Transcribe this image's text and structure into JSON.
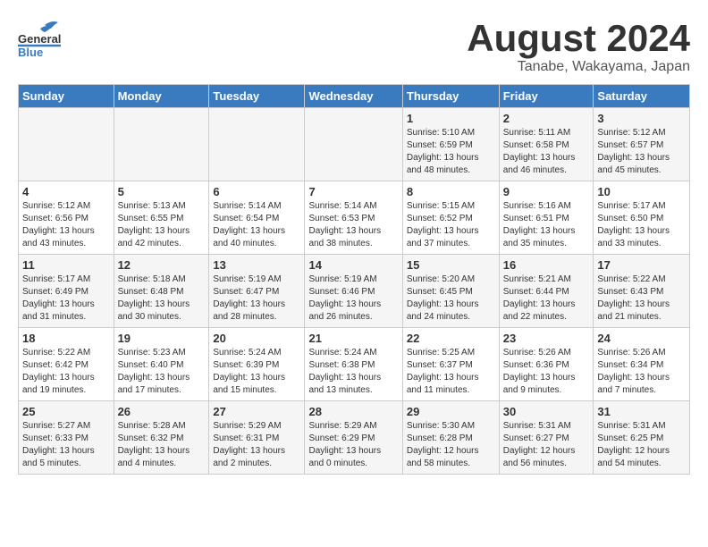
{
  "header": {
    "logo_general": "General",
    "logo_blue": "Blue",
    "title": "August 2024",
    "subtitle": "Tanabe, Wakayama, Japan"
  },
  "columns": [
    "Sunday",
    "Monday",
    "Tuesday",
    "Wednesday",
    "Thursday",
    "Friday",
    "Saturday"
  ],
  "weeks": [
    {
      "days": [
        {
          "num": "",
          "info": ""
        },
        {
          "num": "",
          "info": ""
        },
        {
          "num": "",
          "info": ""
        },
        {
          "num": "",
          "info": ""
        },
        {
          "num": "1",
          "info": "Sunrise: 5:10 AM\nSunset: 6:59 PM\nDaylight: 13 hours\nand 48 minutes."
        },
        {
          "num": "2",
          "info": "Sunrise: 5:11 AM\nSunset: 6:58 PM\nDaylight: 13 hours\nand 46 minutes."
        },
        {
          "num": "3",
          "info": "Sunrise: 5:12 AM\nSunset: 6:57 PM\nDaylight: 13 hours\nand 45 minutes."
        }
      ]
    },
    {
      "days": [
        {
          "num": "4",
          "info": "Sunrise: 5:12 AM\nSunset: 6:56 PM\nDaylight: 13 hours\nand 43 minutes."
        },
        {
          "num": "5",
          "info": "Sunrise: 5:13 AM\nSunset: 6:55 PM\nDaylight: 13 hours\nand 42 minutes."
        },
        {
          "num": "6",
          "info": "Sunrise: 5:14 AM\nSunset: 6:54 PM\nDaylight: 13 hours\nand 40 minutes."
        },
        {
          "num": "7",
          "info": "Sunrise: 5:14 AM\nSunset: 6:53 PM\nDaylight: 13 hours\nand 38 minutes."
        },
        {
          "num": "8",
          "info": "Sunrise: 5:15 AM\nSunset: 6:52 PM\nDaylight: 13 hours\nand 37 minutes."
        },
        {
          "num": "9",
          "info": "Sunrise: 5:16 AM\nSunset: 6:51 PM\nDaylight: 13 hours\nand 35 minutes."
        },
        {
          "num": "10",
          "info": "Sunrise: 5:17 AM\nSunset: 6:50 PM\nDaylight: 13 hours\nand 33 minutes."
        }
      ]
    },
    {
      "days": [
        {
          "num": "11",
          "info": "Sunrise: 5:17 AM\nSunset: 6:49 PM\nDaylight: 13 hours\nand 31 minutes."
        },
        {
          "num": "12",
          "info": "Sunrise: 5:18 AM\nSunset: 6:48 PM\nDaylight: 13 hours\nand 30 minutes."
        },
        {
          "num": "13",
          "info": "Sunrise: 5:19 AM\nSunset: 6:47 PM\nDaylight: 13 hours\nand 28 minutes."
        },
        {
          "num": "14",
          "info": "Sunrise: 5:19 AM\nSunset: 6:46 PM\nDaylight: 13 hours\nand 26 minutes."
        },
        {
          "num": "15",
          "info": "Sunrise: 5:20 AM\nSunset: 6:45 PM\nDaylight: 13 hours\nand 24 minutes."
        },
        {
          "num": "16",
          "info": "Sunrise: 5:21 AM\nSunset: 6:44 PM\nDaylight: 13 hours\nand 22 minutes."
        },
        {
          "num": "17",
          "info": "Sunrise: 5:22 AM\nSunset: 6:43 PM\nDaylight: 13 hours\nand 21 minutes."
        }
      ]
    },
    {
      "days": [
        {
          "num": "18",
          "info": "Sunrise: 5:22 AM\nSunset: 6:42 PM\nDaylight: 13 hours\nand 19 minutes."
        },
        {
          "num": "19",
          "info": "Sunrise: 5:23 AM\nSunset: 6:40 PM\nDaylight: 13 hours\nand 17 minutes."
        },
        {
          "num": "20",
          "info": "Sunrise: 5:24 AM\nSunset: 6:39 PM\nDaylight: 13 hours\nand 15 minutes."
        },
        {
          "num": "21",
          "info": "Sunrise: 5:24 AM\nSunset: 6:38 PM\nDaylight: 13 hours\nand 13 minutes."
        },
        {
          "num": "22",
          "info": "Sunrise: 5:25 AM\nSunset: 6:37 PM\nDaylight: 13 hours\nand 11 minutes."
        },
        {
          "num": "23",
          "info": "Sunrise: 5:26 AM\nSunset: 6:36 PM\nDaylight: 13 hours\nand 9 minutes."
        },
        {
          "num": "24",
          "info": "Sunrise: 5:26 AM\nSunset: 6:34 PM\nDaylight: 13 hours\nand 7 minutes."
        }
      ]
    },
    {
      "days": [
        {
          "num": "25",
          "info": "Sunrise: 5:27 AM\nSunset: 6:33 PM\nDaylight: 13 hours\nand 5 minutes."
        },
        {
          "num": "26",
          "info": "Sunrise: 5:28 AM\nSunset: 6:32 PM\nDaylight: 13 hours\nand 4 minutes."
        },
        {
          "num": "27",
          "info": "Sunrise: 5:29 AM\nSunset: 6:31 PM\nDaylight: 13 hours\nand 2 minutes."
        },
        {
          "num": "28",
          "info": "Sunrise: 5:29 AM\nSunset: 6:29 PM\nDaylight: 13 hours\nand 0 minutes."
        },
        {
          "num": "29",
          "info": "Sunrise: 5:30 AM\nSunset: 6:28 PM\nDaylight: 12 hours\nand 58 minutes."
        },
        {
          "num": "30",
          "info": "Sunrise: 5:31 AM\nSunset: 6:27 PM\nDaylight: 12 hours\nand 56 minutes."
        },
        {
          "num": "31",
          "info": "Sunrise: 5:31 AM\nSunset: 6:25 PM\nDaylight: 12 hours\nand 54 minutes."
        }
      ]
    }
  ]
}
